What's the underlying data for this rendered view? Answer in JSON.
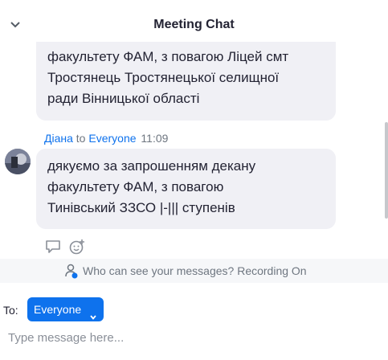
{
  "header": {
    "title": "Meeting Chat",
    "collapse_icon": "chevron-down-icon"
  },
  "messages": [
    {
      "lines": [
        "факультету ФАМ, з повагою Ліцей смт",
        "Тростянець Тростянецької селищної",
        "ради Вінницької області"
      ]
    },
    {
      "sender": "Діана",
      "to_word": "to",
      "recipient": "Everyone",
      "time": "11:09",
      "avatar_icon": "user-avatar",
      "lines": [
        "дякуємо за запрошенням декану",
        "факультету ФАМ, з повагою",
        "Тинівський ЗЗСО |-||| ступенів"
      ]
    }
  ],
  "reactions": {
    "reply_icon": "reply-icon",
    "emoji_icon": "add-emoji-icon"
  },
  "privacy": {
    "text": "Who can see your messages? Recording On",
    "icon": "people-icon"
  },
  "composer": {
    "to_label": "To:",
    "recipient": "Everyone",
    "placeholder": "Type message here..."
  },
  "colors": {
    "accent": "#0e72ed",
    "bubble": "#f0f0f5",
    "privacy_bar": "#f6f7f9"
  }
}
